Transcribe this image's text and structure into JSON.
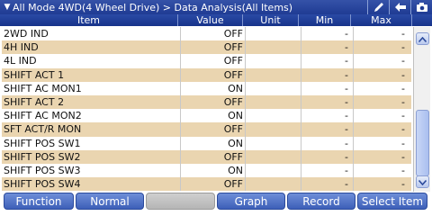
{
  "title": "All Mode 4WD(4 Wheel Drive) > Data Analysis(All Items)",
  "title_buttons": [
    {
      "icon": "pen-icon"
    },
    {
      "icon": "back-arrow-icon"
    },
    {
      "icon": "camera-icon"
    }
  ],
  "columns": {
    "item": "Item",
    "value": "Value",
    "unit": "Unit",
    "min": "Min",
    "max": "Max"
  },
  "rows": [
    {
      "item": "2WD IND",
      "value": "OFF",
      "unit": "",
      "min": "-",
      "max": "-"
    },
    {
      "item": "4H IND",
      "value": "OFF",
      "unit": "",
      "min": "-",
      "max": "-"
    },
    {
      "item": "4L IND",
      "value": "OFF",
      "unit": "",
      "min": "-",
      "max": "-"
    },
    {
      "item": "SHIFT ACT 1",
      "value": "OFF",
      "unit": "",
      "min": "-",
      "max": "-"
    },
    {
      "item": "SHIFT AC MON1",
      "value": "ON",
      "unit": "",
      "min": "-",
      "max": "-"
    },
    {
      "item": "SHIFT ACT 2",
      "value": "OFF",
      "unit": "",
      "min": "-",
      "max": "-"
    },
    {
      "item": "SHIFT AC MON2",
      "value": "ON",
      "unit": "",
      "min": "-",
      "max": "-"
    },
    {
      "item": "SFT ACT/R MON",
      "value": "OFF",
      "unit": "",
      "min": "-",
      "max": "-"
    },
    {
      "item": "SHIFT POS SW1",
      "value": "ON",
      "unit": "",
      "min": "-",
      "max": "-"
    },
    {
      "item": "SHIFT POS SW2",
      "value": "OFF",
      "unit": "",
      "min": "-",
      "max": "-"
    },
    {
      "item": "SHIFT POS SW3",
      "value": "ON",
      "unit": "",
      "min": "-",
      "max": "-"
    },
    {
      "item": "SHIFT POS SW4",
      "value": "OFF",
      "unit": "",
      "min": "-",
      "max": "-"
    }
  ],
  "toolbar": {
    "function": "Function",
    "normal": "Normal",
    "blank": "",
    "graph": "Graph",
    "record": "Record",
    "select_item": "Select Item"
  },
  "colors": {
    "title_bar": "#1f3b93",
    "row_alt": "#ead5b0",
    "button": "#3d5fb8"
  }
}
